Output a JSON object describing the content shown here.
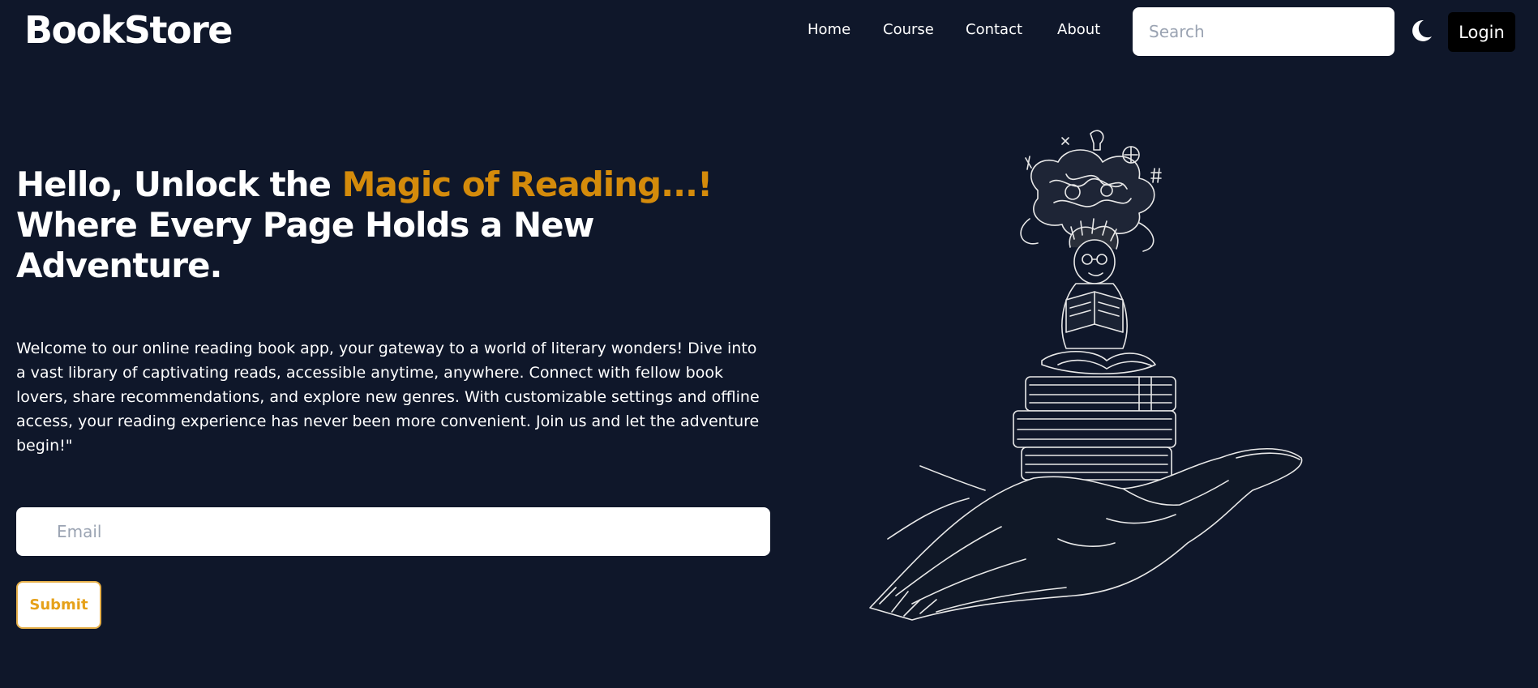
{
  "header": {
    "brand": "BookStore",
    "nav": [
      {
        "label": "Home"
      },
      {
        "label": "Course"
      },
      {
        "label": "Contact"
      },
      {
        "label": "About"
      }
    ],
    "search_placeholder": "Search",
    "theme_icon": "moon-icon",
    "login_label": "Login"
  },
  "hero": {
    "title_prefix": "Hello, Unlock the ",
    "title_accent": "Magic of Reading...!",
    "title_suffix": "Where Every Page Holds a New Adventure.",
    "description": "Welcome to our online reading book app, your gateway to a world of literary wonders! Dive into a vast library of captivating reads, accessible anytime, anywhere. Connect with fellow book lovers, share recommendations, and explore new genres. With customizable settings and offline access, your reading experience has never been more convenient. Join us and let the adventure begin!\"",
    "email_placeholder": "Email",
    "submit_label": "Submit",
    "accent_color": "#d48b0b",
    "illustration": "reader-on-books-in-hand-illustration"
  },
  "colors": {
    "background": "#0f172a",
    "submit_text": "#e6a11a"
  }
}
